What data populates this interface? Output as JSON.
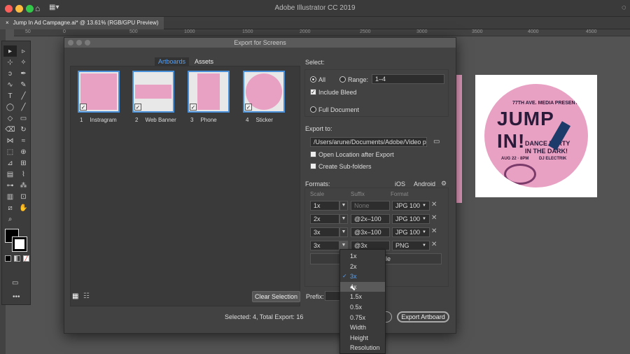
{
  "window": {
    "title": "Adobe Illustrator CC 2019"
  },
  "document_tab": {
    "close": "×",
    "name": "Jump In Ad Campagne.ai* @ 13.61% (RGB/GPU Preview)"
  },
  "ruler": {
    "ticks": [
      "50",
      "0",
      "500",
      "1000",
      "1500",
      "2000",
      "2500",
      "3000",
      "3500",
      "4000",
      "4500"
    ]
  },
  "dialog": {
    "title": "Export for Screens",
    "tabs": [
      "Artboards",
      "Assets"
    ],
    "artboards": [
      {
        "num": "1",
        "name": "Instragram"
      },
      {
        "num": "2",
        "name": "Web Banner"
      },
      {
        "num": "3",
        "name": "Phone"
      },
      {
        "num": "4",
        "name": "Sticker"
      }
    ],
    "clear_selection": "Clear Selection",
    "prefix_label": "Prefix:",
    "status": "Selected: 4, Total Export: 16",
    "select_label": "Select:",
    "all_label": "All",
    "range_label": "Range:",
    "range_value": "1–4",
    "include_bleed": "Include Bleed",
    "full_document": "Full Document",
    "export_to_label": "Export to:",
    "export_path": "/Users/arune/Documents/Adobe/Video p",
    "open_location": "Open Location after Export",
    "create_subfolders": "Create Sub-folders",
    "formats_label": "Formats:",
    "ios": "iOS",
    "android": "Android",
    "col_scale": "Scale",
    "col_suffix": "Suffix",
    "col_format": "Format",
    "rows": [
      {
        "scale": "1x",
        "suffix": "None",
        "format": "JPG 100"
      },
      {
        "scale": "2x",
        "suffix": "@2x–100",
        "format": "JPG 100"
      },
      {
        "scale": "3x",
        "suffix": "@3x–100",
        "format": "JPG 100"
      },
      {
        "scale": "3x",
        "suffix": "@3x",
        "format": "PNG"
      }
    ],
    "add_scale_fragment": "le",
    "export_button": "Export Artboard",
    "scale_menu": [
      "1x",
      "2x",
      "3x",
      "4x",
      "1.5x",
      "0.5x",
      "0.75x",
      "Width",
      "Height",
      "Resolution"
    ],
    "scale_menu_selected": "3x"
  },
  "preview": {
    "line1": "77TH AVE. MEDIA PRESENTS",
    "headline": "JUMP IN!",
    "sub1": "DANCE PARTY",
    "sub2": "IN THE DARK!",
    "date": "AUG 22 · 8PM",
    "dj": "DJ ELECTRIK"
  }
}
